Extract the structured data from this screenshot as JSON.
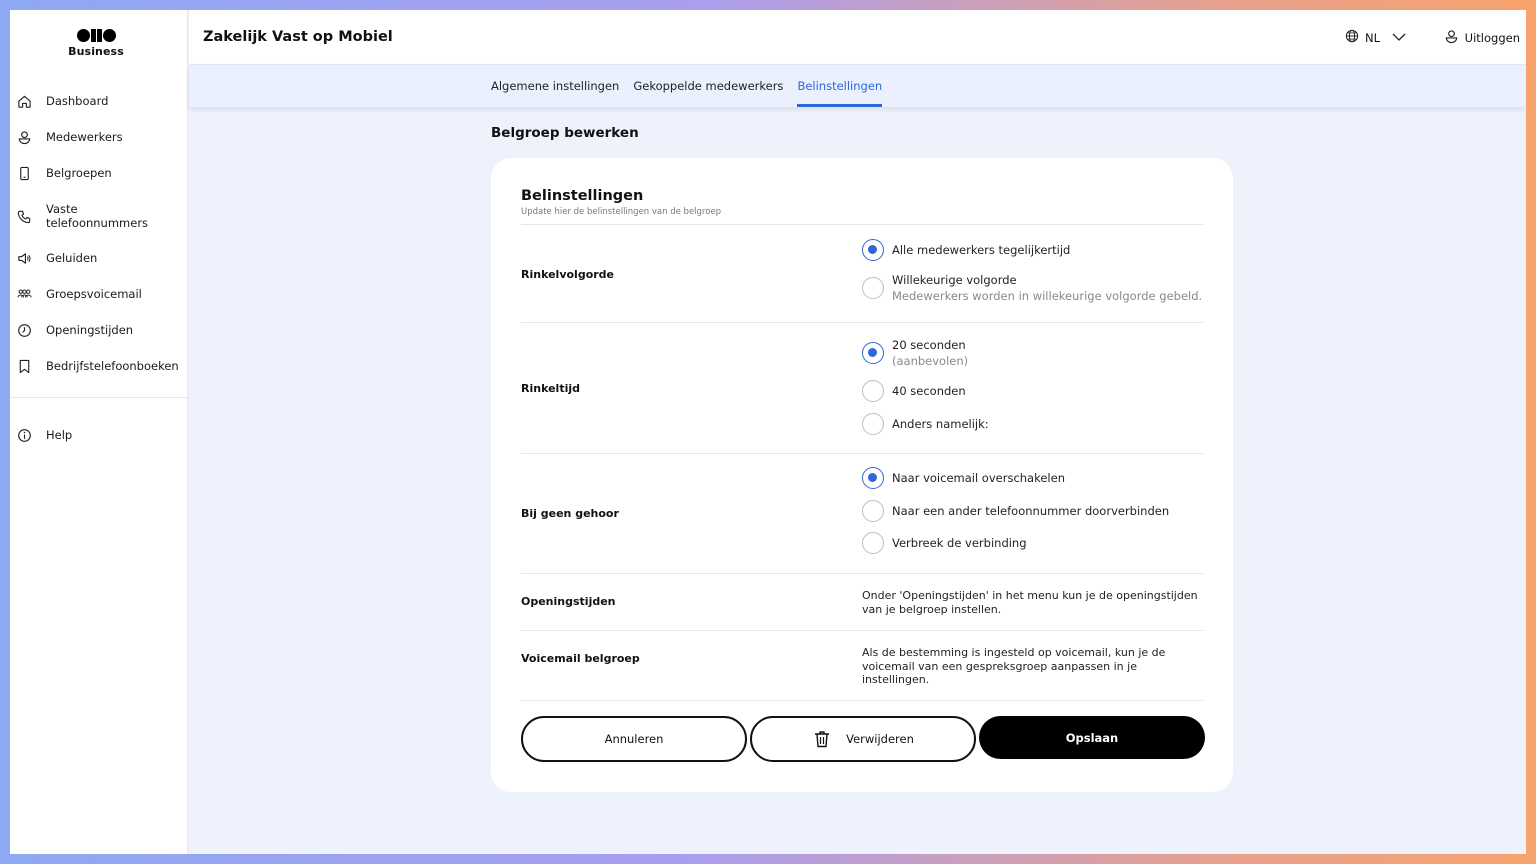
{
  "brand": {
    "logo_text": "Business"
  },
  "sidebar": {
    "items": [
      {
        "label": "Dashboard",
        "icon": "home-icon"
      },
      {
        "label": "Medewerkers",
        "icon": "user-icon"
      },
      {
        "label": "Belgroepen",
        "icon": "phone-device-icon"
      },
      {
        "label": "Vaste telefoonnummers",
        "icon": "phone-handset-icon"
      },
      {
        "label": "Geluiden",
        "icon": "speaker-icon"
      },
      {
        "label": "Groepsvoicemail",
        "icon": "group-icon"
      },
      {
        "label": "Openingstijden",
        "icon": "clock-icon"
      },
      {
        "label": "Bedrijfstelefoonboeken",
        "icon": "bookmark-icon"
      }
    ],
    "help": {
      "label": "Help",
      "icon": "info-icon"
    }
  },
  "header": {
    "title": "Zakelijk Vast op Mobiel",
    "language": "NL",
    "logout_label": "Uitloggen"
  },
  "tabs": [
    {
      "label": "Algemene instellingen",
      "active": false
    },
    {
      "label": "Gekoppelde medewerkers",
      "active": false
    },
    {
      "label": "Belinstellingen",
      "active": true
    }
  ],
  "page": {
    "section_title": "Belgroep bewerken"
  },
  "card": {
    "title": "Belinstellingen",
    "subtitle": "Update hier de belinstellingen van de belgroep",
    "rinkelvolgorde": {
      "label": "Rinkelvolgorde",
      "options": [
        {
          "label": "Alle medewerkers tegelijkertijd",
          "sub": "",
          "selected": true
        },
        {
          "label": "Willekeurige volgorde",
          "sub": "Medewerkers worden in willekeurige volgorde gebeld.",
          "selected": false
        }
      ]
    },
    "rinkeltijd": {
      "label": "Rinkeltijd",
      "options": [
        {
          "label": "20 seconden",
          "sub": "(aanbevolen)",
          "selected": true
        },
        {
          "label": "40 seconden",
          "sub": "",
          "selected": false
        },
        {
          "label": "Anders namelijk:",
          "sub": "",
          "selected": false
        }
      ]
    },
    "geen_gehoor": {
      "label": "Bij geen gehoor",
      "options": [
        {
          "label": "Naar voicemail overschakelen",
          "selected": true
        },
        {
          "label": "Naar een ander telefoonnummer doorverbinden",
          "selected": false
        },
        {
          "label": "Verbreek de verbinding",
          "selected": false
        }
      ]
    },
    "openingstijden": {
      "label": "Openingstijden",
      "text": "Onder 'Openingstijden' in het menu kun je de openingstijden van je belgroep instellen."
    },
    "voicemail": {
      "label": "Voicemail belgroep",
      "text": "Als de bestemming is ingesteld op voicemail, kun je de voicemail van een gespreksgroep aanpassen in je instellingen."
    },
    "buttons": {
      "cancel": "Annuleren",
      "delete": "Verwijderen",
      "save": "Opslaan"
    }
  },
  "colors": {
    "accent": "#2f66d8",
    "background": "#eef2fd",
    "primary_button": "#000000"
  }
}
